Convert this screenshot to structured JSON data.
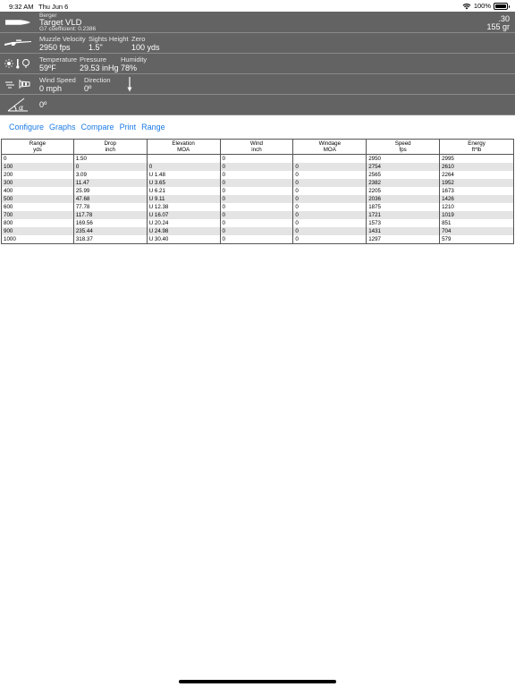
{
  "status": {
    "time": "9:32 AM",
    "date": "Thu Jun 6",
    "battery": "100%"
  },
  "bullet": {
    "maker": "Berger",
    "name": "Target VLD",
    "coef": "G7 coefficient: 0.2386",
    "caliber": ".30",
    "weight": "155 gr"
  },
  "rifle": {
    "muzzle_label": "Muzzle Velocity",
    "sights_label": "Sights Height",
    "zero_label": "Zero",
    "muzzle_val": "2950 fps",
    "sights_val": "1.5\"",
    "zero_val": "100 yds"
  },
  "atmosphere": {
    "temp_label": "Temperature",
    "pressure_label": "Pressure",
    "humidity_label": "Humidity",
    "temp_val": "59ºF",
    "pressure_val": "29.53 inHg",
    "humidity_val": "78%"
  },
  "wind": {
    "speed_label": "Wind Speed",
    "dir_label": "Direction",
    "speed_val": "0 mph",
    "dir_val": "0º"
  },
  "angle": {
    "val": "0º"
  },
  "links": [
    "Configure",
    "Graphs",
    "Compare",
    "Print",
    "Range"
  ],
  "table": {
    "headers": [
      [
        "Range",
        "yds"
      ],
      [
        "Drop",
        "inch"
      ],
      [
        "Elevation",
        "MOA"
      ],
      [
        "Wind",
        "inch"
      ],
      [
        "Windage",
        "MOA"
      ],
      [
        "Speed",
        "fps"
      ],
      [
        "Energy",
        "ft*lb"
      ]
    ],
    "rows": [
      [
        "0",
        "1.50",
        "",
        "0",
        "",
        "2950",
        "2995"
      ],
      [
        "100",
        "0",
        "0",
        "0",
        "0",
        "2754",
        "2610"
      ],
      [
        "200",
        "3.09",
        "U 1.48",
        "0",
        "0",
        "2565",
        "2264"
      ],
      [
        "300",
        "11.47",
        "U 3.65",
        "0",
        "0",
        "2382",
        "1952"
      ],
      [
        "400",
        "25.99",
        "U 6.21",
        "0",
        "0",
        "2205",
        "1673"
      ],
      [
        "500",
        "47.68",
        "U 9.11",
        "0",
        "0",
        "2036",
        "1426"
      ],
      [
        "600",
        "77.78",
        "U 12.38",
        "0",
        "0",
        "1875",
        "1210"
      ],
      [
        "700",
        "117.78",
        "U 16.07",
        "0",
        "0",
        "1721",
        "1019"
      ],
      [
        "800",
        "169.56",
        "U 20.24",
        "0",
        "0",
        "1573",
        "851"
      ],
      [
        "900",
        "235.44",
        "U 24.98",
        "0",
        "0",
        "1431",
        "704"
      ],
      [
        "1000",
        "318.37",
        "U 30.40",
        "0",
        "0",
        "1297",
        "579"
      ]
    ]
  }
}
